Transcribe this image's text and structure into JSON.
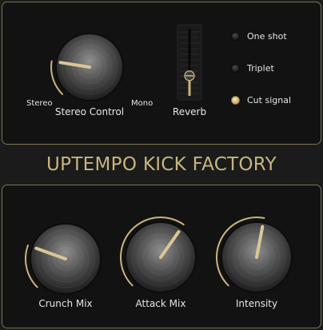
{
  "title": "UPTEMPO KICK FACTORY",
  "colors": {
    "accent": "#c8b57e",
    "border": "#7d7452",
    "panel": "#121212",
    "background": "#1b1b1b"
  },
  "top": {
    "stereo_control": {
      "label": "Stereo Control",
      "min_label": "Stereo",
      "max_label": "Mono",
      "value": 0.2
    },
    "reverb": {
      "label": "Reverb",
      "value": 0.3
    },
    "toggles": [
      {
        "label": "One shot",
        "on": false
      },
      {
        "label": "Triplet",
        "on": false
      },
      {
        "label": "Cut signal",
        "on": true
      }
    ]
  },
  "bottom": {
    "knobs": [
      {
        "label": "Crunch Mix",
        "value": 0.24
      },
      {
        "label": "Attack Mix",
        "value": 0.63
      },
      {
        "label": "Intensity",
        "value": 0.54
      }
    ]
  }
}
